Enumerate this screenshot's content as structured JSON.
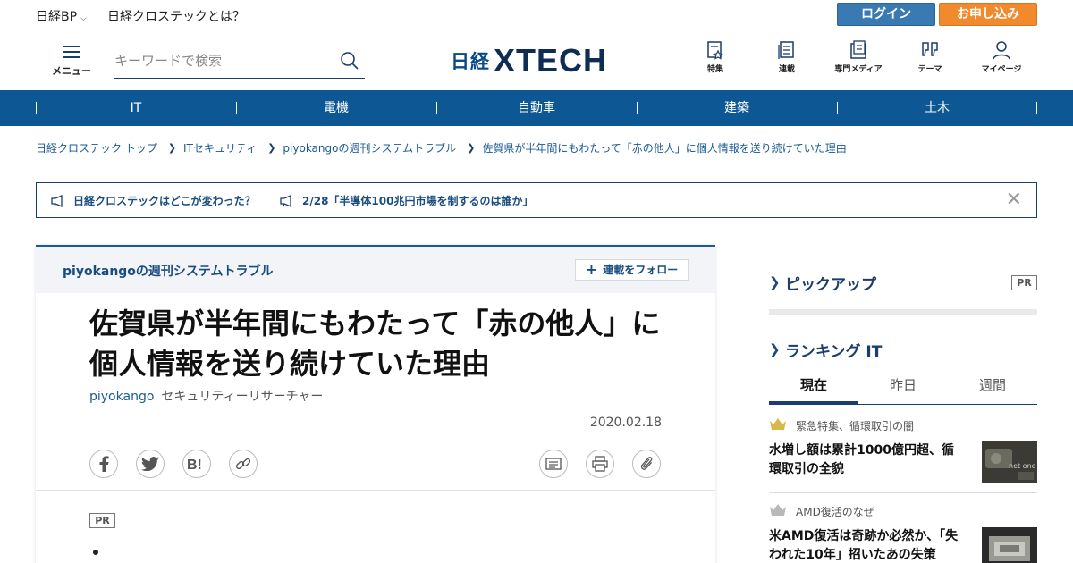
{
  "topbar": {
    "brand": "日経BP",
    "about": "日経クロステックとは？",
    "login": "ログイン",
    "signup": "お申し込み"
  },
  "header": {
    "menu_label": "メニュー",
    "search_placeholder": "キーワードで検索",
    "logo_prefix": "日経",
    "logo_main": "XTECH",
    "icons": [
      {
        "label": "特集",
        "icon": "feature-icon"
      },
      {
        "label": "連載",
        "icon": "series-icon"
      },
      {
        "label": "専門メディア",
        "icon": "media-icon"
      },
      {
        "label": "テーマ",
        "icon": "theme-icon"
      },
      {
        "label": "マイページ",
        "icon": "user-icon"
      }
    ]
  },
  "catnav": [
    "IT",
    "電機",
    "自動車",
    "建築",
    "土木"
  ],
  "breadcrumb": [
    "日経クロステック トップ",
    "ITセキュリティ",
    "piyokangoの週刊システムトラブル",
    "佐賀県が半年間にもわたって「赤の他人」に個人情報を送り続けていた理由"
  ],
  "notice": {
    "items": [
      "日経クロステックはどこが変わった？",
      "2/28「半導体100兆円市場を制するのは誰か」"
    ]
  },
  "article": {
    "series": "piyokangoの週刊システムトラブル",
    "follow": "連載をフォロー",
    "title": "佐賀県が半年間にもわたって「赤の他人」に個人情報を送り続けていた理由",
    "author": "piyokango",
    "author_role": "セキュリティーリサーチャー",
    "date": "2020.02.18",
    "pr": "PR",
    "share_icons": [
      "facebook-icon",
      "twitter-icon",
      "hatena-bookmark-icon",
      "link-icon"
    ],
    "tool_icons": [
      "article-list-icon",
      "print-icon",
      "clip-icon"
    ]
  },
  "sidebar": {
    "pickup": {
      "title": "ピックアップ",
      "pr": "PR"
    },
    "ranking": {
      "title": "ランキング IT",
      "tabs": [
        "現在",
        "昨日",
        "週間"
      ],
      "active_tab": 0,
      "items": [
        {
          "category": "緊急特集、循環取引の闇",
          "headline": "水増し額は累計1000億円超、循環取引の全貌"
        },
        {
          "category": "AMD復活のなぜ",
          "headline": "米AMD復活は奇跡か必然か、「失われた10年」招いたあの失策"
        }
      ]
    }
  },
  "colors": {
    "brand_navy": "#1a3d6b",
    "nav_blue": "#0d5794",
    "login": "#3a7ab2",
    "signup": "#f08a2c"
  }
}
